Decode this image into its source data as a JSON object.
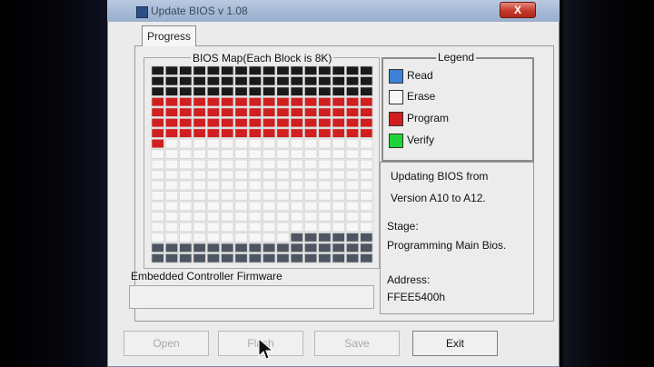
{
  "window": {
    "title": "Update BIOS v 1.08",
    "close_label": "X"
  },
  "tabs": [
    {
      "label": "Progress",
      "active": true
    }
  ],
  "bios_map": {
    "title": "BIOS Map(Each Block is 8K)",
    "columns": 16,
    "rows": [
      [
        "b",
        "b",
        "b",
        "b",
        "b",
        "b",
        "b",
        "b",
        "b",
        "b",
        "b",
        "b",
        "b",
        "b",
        "b",
        "b"
      ],
      [
        "b",
        "b",
        "b",
        "b",
        "b",
        "b",
        "b",
        "b",
        "b",
        "b",
        "b",
        "b",
        "b",
        "b",
        "b",
        "b"
      ],
      [
        "b",
        "b",
        "b",
        "b",
        "b",
        "b",
        "b",
        "b",
        "b",
        "b",
        "b",
        "b",
        "b",
        "b",
        "b",
        "b"
      ],
      [
        "r",
        "r",
        "r",
        "r",
        "r",
        "r",
        "r",
        "r",
        "r",
        "r",
        "r",
        "r",
        "r",
        "r",
        "r",
        "r"
      ],
      [
        "r",
        "r",
        "r",
        "r",
        "r",
        "r",
        "r",
        "r",
        "r",
        "r",
        "r",
        "r",
        "r",
        "r",
        "r",
        "r"
      ],
      [
        "r",
        "r",
        "r",
        "r",
        "r",
        "r",
        "r",
        "r",
        "r",
        "r",
        "r",
        "r",
        "r",
        "r",
        "r",
        "r"
      ],
      [
        "r",
        "r",
        "r",
        "r",
        "r",
        "r",
        "r",
        "r",
        "r",
        "r",
        "r",
        "r",
        "r",
        "r",
        "r",
        "r"
      ],
      [
        "r",
        "w",
        "w",
        "w",
        "w",
        "w",
        "w",
        "w",
        "w",
        "w",
        "w",
        "w",
        "w",
        "w",
        "w",
        "w"
      ],
      [
        "w",
        "w",
        "w",
        "w",
        "w",
        "w",
        "w",
        "w",
        "w",
        "w",
        "w",
        "w",
        "w",
        "w",
        "w",
        "w"
      ],
      [
        "w",
        "w",
        "w",
        "w",
        "w",
        "w",
        "w",
        "w",
        "w",
        "w",
        "w",
        "w",
        "w",
        "w",
        "w",
        "w"
      ],
      [
        "w",
        "w",
        "w",
        "w",
        "w",
        "w",
        "w",
        "w",
        "w",
        "w",
        "w",
        "w",
        "w",
        "w",
        "w",
        "w"
      ],
      [
        "w",
        "w",
        "w",
        "w",
        "w",
        "w",
        "w",
        "w",
        "w",
        "w",
        "w",
        "w",
        "w",
        "w",
        "w",
        "w"
      ],
      [
        "w",
        "w",
        "w",
        "w",
        "w",
        "w",
        "w",
        "w",
        "w",
        "w",
        "w",
        "w",
        "w",
        "w",
        "w",
        "w"
      ],
      [
        "w",
        "w",
        "w",
        "w",
        "w",
        "w",
        "w",
        "w",
        "w",
        "w",
        "w",
        "w",
        "w",
        "w",
        "w",
        "w"
      ],
      [
        "w",
        "w",
        "w",
        "w",
        "w",
        "w",
        "w",
        "w",
        "w",
        "w",
        "w",
        "w",
        "w",
        "w",
        "w",
        "w"
      ],
      [
        "w",
        "w",
        "w",
        "w",
        "w",
        "w",
        "w",
        "w",
        "w",
        "w",
        "w",
        "w",
        "w",
        "w",
        "w",
        "w"
      ],
      [
        "w",
        "w",
        "w",
        "w",
        "w",
        "w",
        "w",
        "w",
        "w",
        "w",
        "g",
        "g",
        "g",
        "g",
        "g",
        "g"
      ],
      [
        "g",
        "g",
        "g",
        "g",
        "g",
        "g",
        "g",
        "g",
        "g",
        "g",
        "g",
        "g",
        "g",
        "g",
        "g",
        "g"
      ],
      [
        "g",
        "g",
        "g",
        "g",
        "g",
        "g",
        "g",
        "g",
        "g",
        "g",
        "g",
        "g",
        "g",
        "g",
        "g",
        "g"
      ]
    ],
    "state_colors": {
      "b": "#1a1a1a",
      "r": "#d11e1e",
      "w": "#f7f7f7",
      "g": "#4e5562"
    }
  },
  "legend": {
    "title": "Legend",
    "items": [
      {
        "label": "Read",
        "color": "#3b82d6"
      },
      {
        "label": "Erase",
        "color": "#f7f7f7"
      },
      {
        "label": "Program",
        "color": "#d11e1e"
      },
      {
        "label": "Verify",
        "color": "#1fd43a"
      }
    ]
  },
  "status": {
    "line1": "Updating BIOS from",
    "line2": "Version A10 to A12.",
    "stage_label": "Stage:",
    "stage_value": "Programming Main Bios.",
    "address_label": "Address:",
    "address_value": "FFEE5400h"
  },
  "ec_firmware": {
    "label": "Embedded Controller Firmware",
    "value": ""
  },
  "buttons": {
    "open": {
      "label": "Open",
      "enabled": false
    },
    "flash": {
      "label": "Flash",
      "enabled": false
    },
    "save": {
      "label": "Save",
      "enabled": false
    },
    "exit": {
      "label": "Exit",
      "enabled": true
    }
  },
  "icons": {
    "app": "app-icon",
    "cursor": "mouse-pointer-icon"
  }
}
